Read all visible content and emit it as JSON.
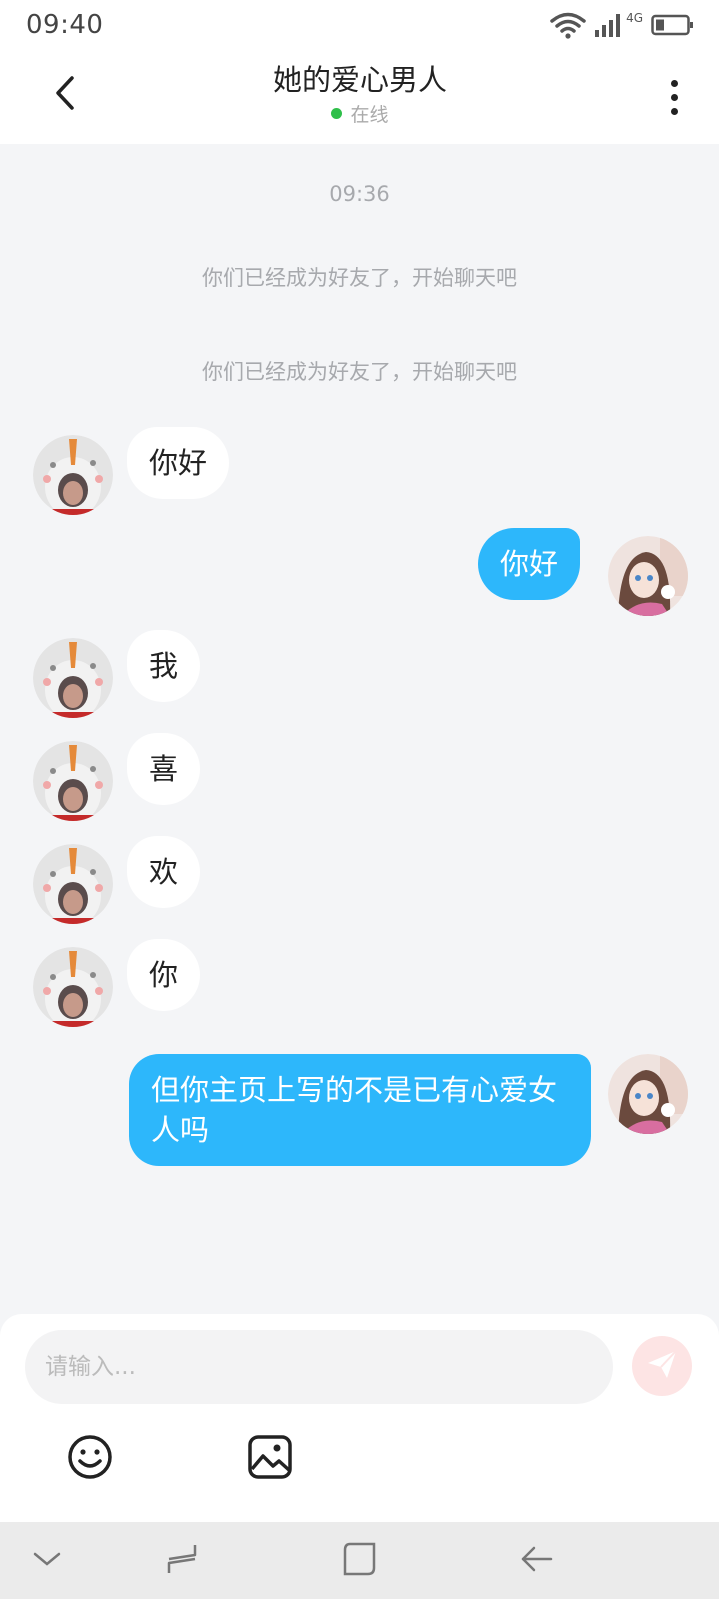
{
  "status_bar": {
    "time": "09:40",
    "network": "4G",
    "icons": [
      "wifi-icon",
      "signal-icon",
      "battery-icon"
    ]
  },
  "header": {
    "title": "她的爱心男人",
    "status": "在线",
    "back_icon": "chevron-left-icon",
    "more_icon": "more-vertical-icon"
  },
  "chat": {
    "timestamp": "09:36",
    "system_messages": [
      "你们已经成为好友了，开始聊天吧",
      "你们已经成为好友了，开始聊天吧"
    ],
    "messages": [
      {
        "from": "other",
        "text": "你好"
      },
      {
        "from": "me",
        "text": "你好"
      },
      {
        "from": "other",
        "text": "我"
      },
      {
        "from": "other",
        "text": "喜"
      },
      {
        "from": "other",
        "text": "欢"
      },
      {
        "from": "other",
        "text": "你"
      },
      {
        "from": "me",
        "text": "但你主页上写的不是已有心爱女人吗"
      }
    ]
  },
  "composer": {
    "placeholder": "请输入...",
    "value": "",
    "send_icon": "send-icon",
    "tools": [
      "emoji-icon",
      "image-icon"
    ]
  },
  "nav_bar": {
    "buttons": [
      "chevron-down-icon",
      "recent-apps-icon",
      "home-icon",
      "back-arrow-icon"
    ]
  },
  "colors": {
    "accent": "#2db7fb",
    "background": "#f4f5f7",
    "online": "#2fbf4a",
    "send_button": "#fde4e4"
  }
}
